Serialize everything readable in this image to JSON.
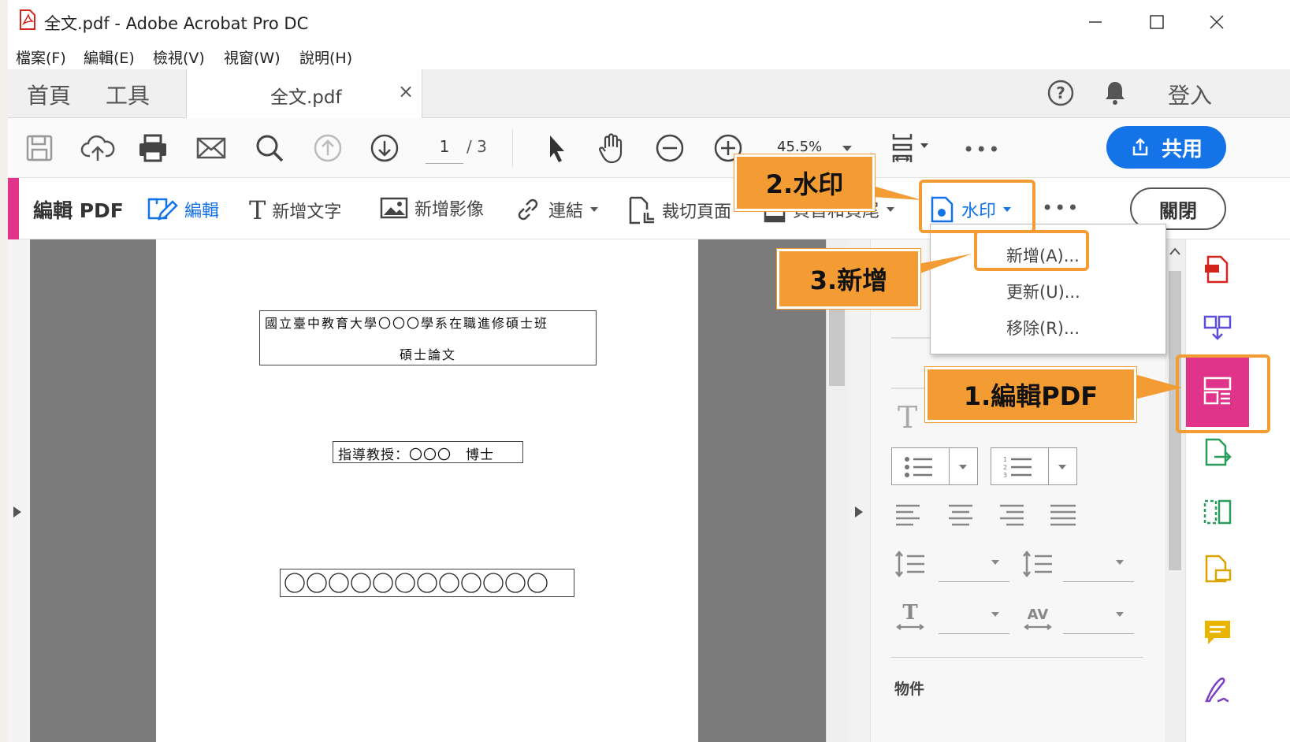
{
  "window": {
    "title": "全文.pdf - Adobe Acrobat Pro DC"
  },
  "menu": {
    "items": [
      "檔案(F)",
      "編輯(E)",
      "檢視(V)",
      "視窗(W)",
      "說明(H)"
    ]
  },
  "tabs": {
    "home": "首頁",
    "tools": "工具",
    "document": "全文.pdf",
    "close": "×",
    "sign_in": "登入"
  },
  "toolbar": {
    "page_current": "1",
    "page_total": "/ 3",
    "zoom": "45.5%",
    "share": "共用"
  },
  "edit_toolbar": {
    "title": "編輯 PDF",
    "edit": "編輯",
    "add_text": "新增文字",
    "add_image": "新增影像",
    "link": "連結",
    "crop": "裁切頁面",
    "header_footer": "頁首和頁尾",
    "watermark": "水印",
    "close": "關閉"
  },
  "watermark_menu": {
    "items": [
      "新增(A)...",
      "更新(U)...",
      "移除(R)..."
    ]
  },
  "document": {
    "title_line1": "國立臺中教育大學〇〇〇學系在職進修碩士班",
    "title_line2": "碩士論文",
    "advisor": "指導教授：〇〇〇　博士",
    "author_circles": 12
  },
  "properties_panel": {
    "section_objects": "物件"
  },
  "callouts": {
    "step1": "1.編輯PDF",
    "step2": "2.水印",
    "step3": "3.新增"
  },
  "colors": {
    "accent_pink": "#e0338a",
    "callout_orange": "#f39c33",
    "share_blue": "#1473e6"
  }
}
